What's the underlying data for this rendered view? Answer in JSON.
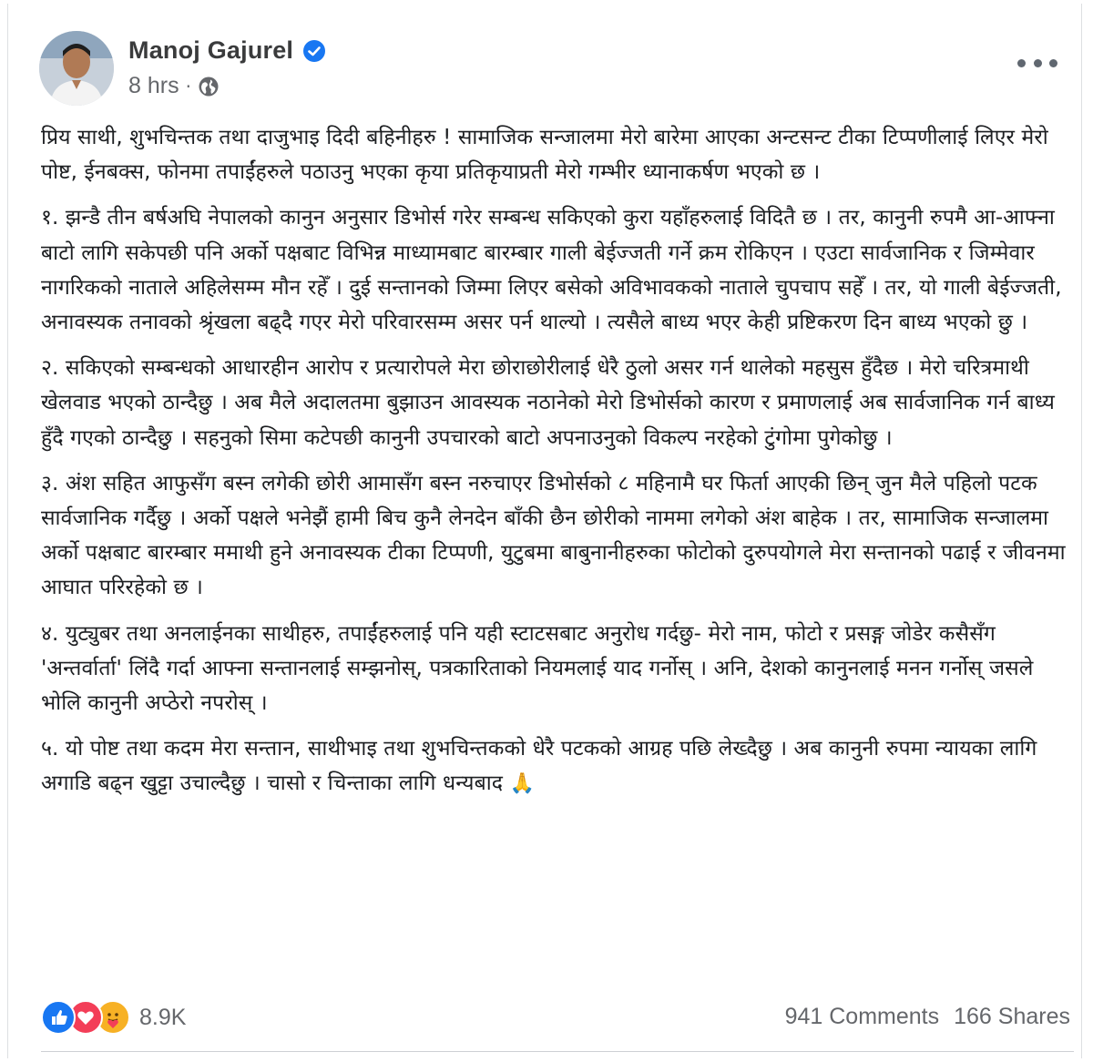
{
  "post": {
    "author": "Manoj Gajurel",
    "timestamp": "8 hrs",
    "separator": "·",
    "verified_icon": "verified-badge-icon",
    "audience_icon": "globe-icon",
    "paragraphs": [
      "प्रिय साथी, शुभचिन्तक तथा दाजुभाइ दिदी बहिनीहरु ! सामाजिक सन्जालमा मेरो बारेमा आएका अन्टसन्ट टीका टिप्पणीलाई लिएर मेरो पोष्ट, ईनबक्स, फोनमा तपाईंहरुले पठाउनु भएका कृया प्रतिकृयाप्रती मेरो गम्भीर ध्यानाकर्षण भएको छ ।",
      "१. झन्डै तीन बर्षअघि नेपालको कानुन अनुसार डिभोर्स गरेर सम्बन्ध सकिएको कुरा यहाँहरुलाई विदितै छ । तर, कानुनी रुपमै आ-आफ्ना बाटो लागि सकेपछी पनि अर्को पक्षबाट विभिन्न माध्यामबाट बारम्बार गाली बेईज्जती गर्ने क्रम रोकिएन । एउटा सार्वजानिक र जिम्मेवार नागरिकको नाताले अहिलेसम्म मौन रहेँ । दुई सन्तानको जिम्मा लिएर बसेको अविभावकको नाताले चुपचाप सहेँ । तर, यो गाली बेईज्जती, अनावस्यक तनावको श्रृंखला बढ्दै गएर मेरो परिवारसम्म असर पर्न थाल्यो । त्यसैले बाध्य भएर केही प्रष्टिकरण दिन बाध्य भएको छु ।",
      "२. सकिएको सम्बन्धको आधारहीन आरोप र प्रत्यारोपले मेरा छोराछोरीलाई धेरै ठुलो असर गर्न थालेको महसुस हुँदैछ । मेरो चरित्रमाथी खेलवाड भएको ठान्दैछु । अब मैले अदालतमा बुझाउन आवस्यक नठानेको मेरो डिभोर्सको कारण र प्रमाणलाई अब सार्वजानिक गर्न बाध्य हुँदै गएको ठान्दैछु । सहनुको सिमा कटेपछी कानुनी उपचारको बाटो अपनाउनुको विकल्प नरहेको टुंगोमा पुगेकोछु ।",
      "३. अंश सहित आफुसँग बस्न लगेकी छोरी आमासँग बस्न नरुचाएर डिभोर्सको ८ महिनामै घर फिर्ता आएकी छिन् जुन मैले पहिलो पटक सार्वजानिक गर्दैछु । अर्को पक्षले भनेझैं हामी बिच कुनै लेनदेन बाँकी छैन छोरीको नाममा लगेको अंश बाहेक । तर, सामाजिक सन्जालमा अर्को पक्षबाट बारम्बार ममाथी हुने अनावस्यक टीका टिप्पणी, युटुबमा बाबुनानीहरुका फोटोको दुरुपयोगले मेरा सन्तानको पढाई र जीवनमा आघात परिरहेको छ ।",
      "४. युट्युबर तथा अनलाईनका साथीहरु, तपाईंहरुलाई पनि यही स्टाटसबाट अनुरोध गर्दछु- मेरो नाम, फोटो र प्रसङ्ग जोडेर कसैसँग 'अन्तर्वार्ता' लिंदै गर्दा आफ्ना सन्तानलाई सम्झनोस्, पत्रकारिताको नियमलाई याद गर्नोस् । अनि, देशको कानुनलाई मनन गर्नोस् जसले भोलि कानुनी अप्ठेरो नपरोस् ।",
      "५. यो पोष्ट तथा कदम मेरा सन्तान, साथीभाइ तथा शुभचिन्तकको धेरै पटकको आग्रह पछि लेख्दैछु । अब कानुनी रुपमा न्यायका लागि अगाडि बढ्न खुट्टा उचाल्दैछु । चासो र चिन्ताका लागि धन्यबाद"
    ],
    "closing_emoji": "🙏",
    "reactions": {
      "icons": [
        "like-icon",
        "love-icon",
        "care-icon"
      ],
      "count": "8.9K"
    },
    "comments_label": "941 Comments",
    "shares_label": "166 Shares"
  },
  "colors": {
    "text": "#1c1e21",
    "meta": "#65676b",
    "like": "#1877f2",
    "love": "#f33e58",
    "care": "#f7b125"
  }
}
